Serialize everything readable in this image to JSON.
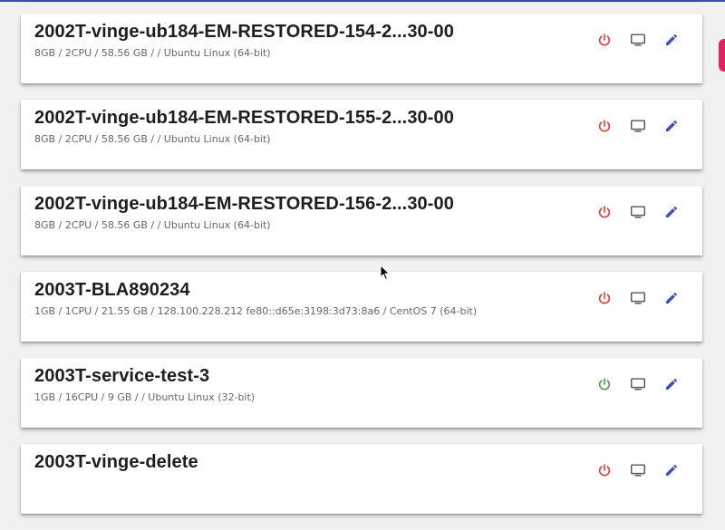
{
  "colors": {
    "header_accent": "#3f51b5",
    "power_off": "#e53935",
    "power_on": "#43a047",
    "display": "#555555",
    "edit": "#3f51b5",
    "side_tab": "#e91e63"
  },
  "icons": {
    "power": "power-icon",
    "console": "monitor-icon",
    "edit": "pencil-icon"
  },
  "vms": [
    {
      "name": "",
      "specs": "",
      "power_state": "off"
    },
    {
      "name": "2002T-vinge-ub184-EM-RESTORED-154-2...30-00",
      "specs": "8GB / 2CPU / 58.56 GB / / Ubuntu Linux (64-bit)",
      "power_state": "off"
    },
    {
      "name": "2002T-vinge-ub184-EM-RESTORED-155-2...30-00",
      "specs": "8GB / 2CPU / 58.56 GB / / Ubuntu Linux (64-bit)",
      "power_state": "off"
    },
    {
      "name": "2002T-vinge-ub184-EM-RESTORED-156-2...30-00",
      "specs": "8GB / 2CPU / 58.56 GB / / Ubuntu Linux (64-bit)",
      "power_state": "off"
    },
    {
      "name": "2003T-BLA890234",
      "specs": "1GB / 1CPU / 21.55 GB / 128.100.228.212 fe80::d65e:3198:3d73:8a6 / CentOS 7 (64-bit)",
      "power_state": "off"
    },
    {
      "name": "2003T-service-test-3",
      "specs": "1GB / 16CPU / 9 GB / / Ubuntu Linux (32-bit)",
      "power_state": "on"
    },
    {
      "name": "2003T-vinge-delete",
      "specs": "",
      "power_state": "off"
    }
  ]
}
